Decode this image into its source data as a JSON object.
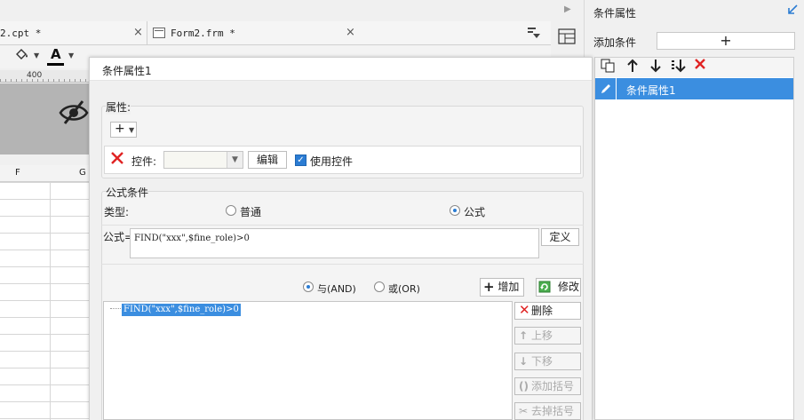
{
  "editor": {
    "tabs": [
      {
        "label": "2.cpt *",
        "close": "×"
      },
      {
        "label": "Form2.frm *",
        "close": "×"
      }
    ],
    "tab_menu_icon": "dropdown-menu-icon",
    "ruler_mark": "400",
    "columns": [
      "F",
      "G"
    ]
  },
  "right_panel": {
    "title": "条件属性",
    "add_condition_label": "添加条件",
    "add_button_glyph": "+",
    "toolbar_icons": [
      "copy-icon",
      "move-up-icon",
      "move-down-icon",
      "move-bottom-icon",
      "delete-icon"
    ],
    "items": [
      {
        "label": "条件属性1",
        "selected": true
      }
    ]
  },
  "dialog": {
    "title": "条件属性1",
    "property": {
      "label": "属性:",
      "add_glyph": "+",
      "control_label": "控件:",
      "control_value": "",
      "edit_button": "编辑",
      "use_control_label": "使用控件",
      "use_control_checked": true
    },
    "formula_condition": {
      "label": "公式条件",
      "type_label": "类型:",
      "type_options": [
        "普通",
        "公式"
      ],
      "type_selected": "公式",
      "formula_label": "公式=",
      "formula_value": "FIND(\"xxx\",$fine_role)>0",
      "define_button": "定义",
      "logic_and": "与(AND)",
      "logic_or": "或(OR)",
      "logic_selected": "与(AND)",
      "add_button": "增加",
      "modify_button": "修改",
      "conditions": [
        "FIND(\"xxx\",$fine_role)>0"
      ],
      "side_buttons": {
        "delete": "删除",
        "move_up": "上移",
        "move_down": "下移",
        "add_bracket": "添加括号",
        "remove_bracket": "去掉括号"
      }
    }
  },
  "colors": {
    "accent": "#3b8ee0",
    "danger": "#e02424"
  }
}
